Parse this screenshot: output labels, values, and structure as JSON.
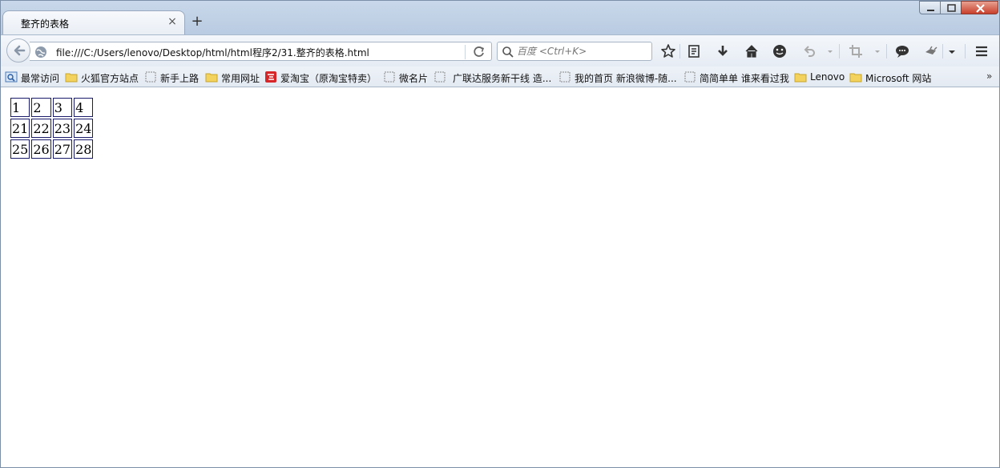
{
  "tab": {
    "title": "整齐的表格",
    "close": "×",
    "new_tab": "+"
  },
  "navbar": {
    "url": "file:///C:/Users/lenovo/Desktop/html/html程序2/31.整齐的表格.html",
    "search_placeholder": "百度 <Ctrl+K>"
  },
  "bookmarks": {
    "items": [
      {
        "label": "最常访问",
        "icon": "most-visited-icon"
      },
      {
        "label": "火狐官方站点",
        "icon": "folder-icon"
      },
      {
        "label": "新手上路",
        "icon": "page-icon"
      },
      {
        "label": "常用网址",
        "icon": "folder-icon"
      },
      {
        "label": "爱淘宝（原淘宝特卖）",
        "icon": "taobao-icon"
      },
      {
        "label": "微名片",
        "icon": "page-icon"
      },
      {
        "label": "广联达服务新干线 造...",
        "icon": "page-icon"
      },
      {
        "label": "我的首页 新浪微博-随...",
        "icon": "page-icon"
      },
      {
        "label": "简简单单 谁来看过我",
        "icon": "page-icon"
      },
      {
        "label": "Lenovo",
        "icon": "folder-icon"
      },
      {
        "label": "Microsoft 网站",
        "icon": "folder-icon"
      }
    ],
    "more": "»"
  },
  "table": {
    "rows": [
      [
        "1",
        "2",
        "3",
        "4"
      ],
      [
        "21",
        "22",
        "23",
        "24"
      ],
      [
        "25",
        "26",
        "27",
        "28"
      ]
    ]
  },
  "colors": {
    "accent": "#1a1a6a",
    "toolbar": "#e6ecf4",
    "close_button": "#c8402c"
  }
}
